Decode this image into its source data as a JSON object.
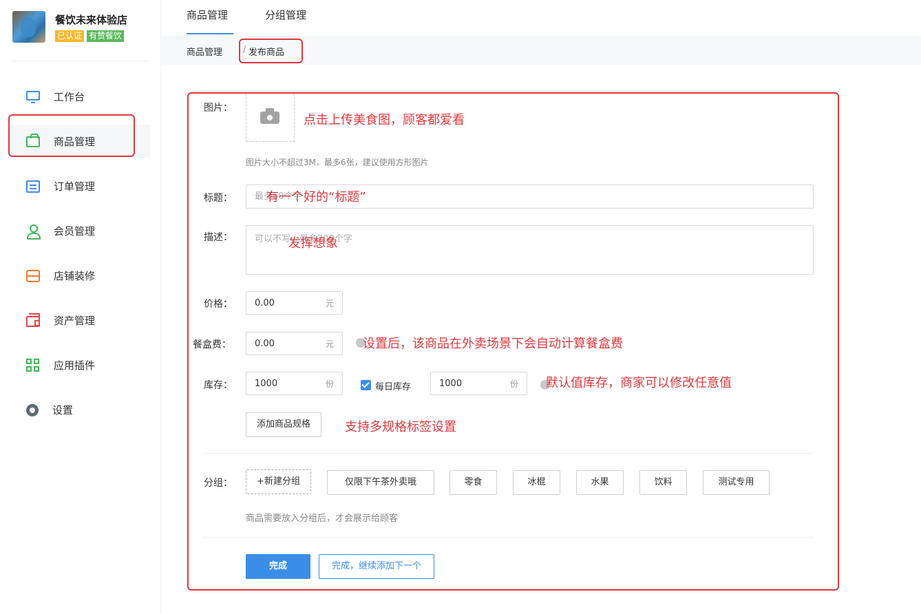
{
  "store": {
    "name": "餐饮未来体验店",
    "badges": [
      "已认证",
      "有赞餐饮"
    ]
  },
  "sidebar": {
    "items": [
      {
        "label": "工作台",
        "icon": "monitor-icon"
      },
      {
        "label": "商品管理",
        "icon": "bag-icon"
      },
      {
        "label": "订单管理",
        "icon": "order-list-icon"
      },
      {
        "label": "会员管理",
        "icon": "user-icon"
      },
      {
        "label": "店铺装修",
        "icon": "store-icon"
      },
      {
        "label": "资产管理",
        "icon": "wallet-icon"
      },
      {
        "label": "应用插件",
        "icon": "apps-icon"
      },
      {
        "label": "设置",
        "icon": "gear-icon"
      }
    ],
    "active_index": 1
  },
  "tabs": [
    {
      "label": "商品管理"
    },
    {
      "label": "分组管理"
    }
  ],
  "breadcrumb": [
    "商品管理",
    "/",
    "发布商品"
  ],
  "form": {
    "image": {
      "label": "图片：",
      "hint": "图片大小不超过3M，最多6张，建议使用方形图片",
      "note": "点击上传美食图，顾客都爱看"
    },
    "title": {
      "label": "标题：",
      "placeholder": "最多60个字",
      "note": "有一个好的“标题”"
    },
    "description": {
      "label": "描述：",
      "placeholder": "可以不写，最多200个字",
      "note": "发挥想象"
    },
    "price": {
      "label": "价格：",
      "value": "0.00",
      "unit": "元"
    },
    "box_fee": {
      "label": "餐盒费：",
      "value": "0.00",
      "unit": "元",
      "note": "设置后，该商品在外卖场景下会自动计算餐盒费"
    },
    "stock": {
      "label": "库存：",
      "value": "1000",
      "unit": "份",
      "daily_label": "每日库存",
      "daily_checked": true,
      "daily_value": "1000",
      "daily_unit": "份",
      "note": "默认值库存，商家可以修改任意值"
    },
    "spec": {
      "button": "添加商品规格",
      "note": "支持多规格标签设置"
    },
    "group": {
      "label": "分组：",
      "new_button": "+新建分组",
      "options": [
        "仅限下午茶外卖哦",
        "零食",
        "冰棍",
        "水果",
        "饮料",
        "测试专用"
      ],
      "hint": "商品需要放入分组后，才会展示给顾客"
    },
    "actions": {
      "done": "完成",
      "done_continue": "完成，继续添加下一个"
    }
  },
  "colors": {
    "accent": "#3b8ee8",
    "annotation": "#e0393e",
    "badge_yellow": "#f5b82e",
    "badge_green": "#5cb85c"
  }
}
